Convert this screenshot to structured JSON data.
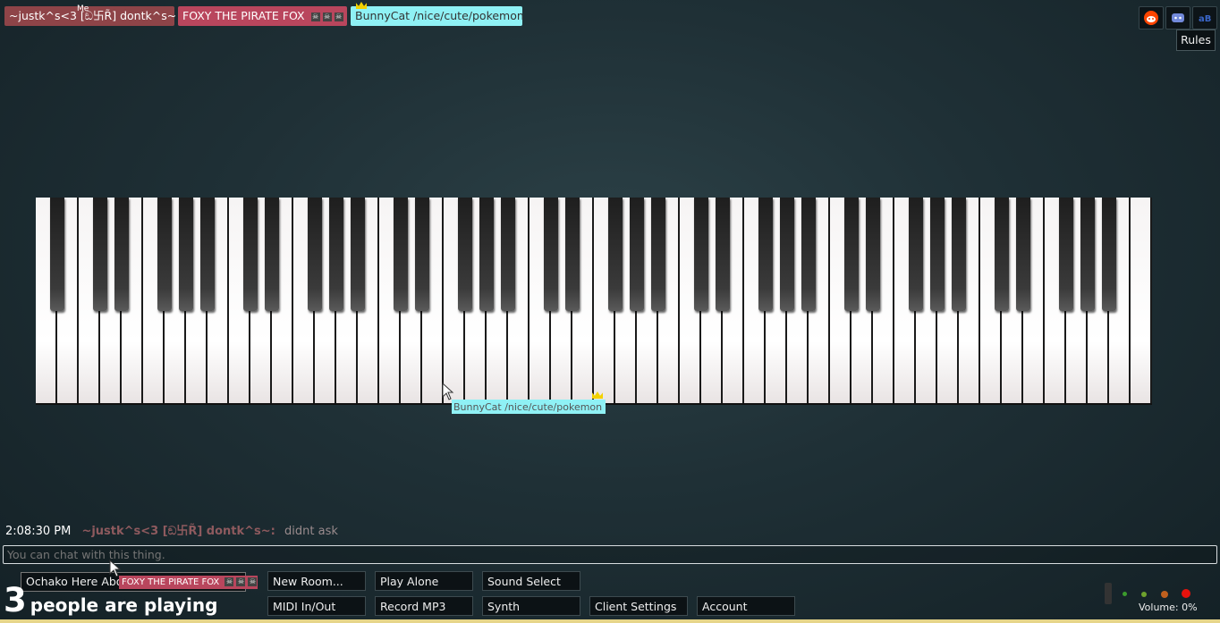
{
  "top_users": [
    {
      "name": "~justk^s<3 [ඞ卐R̃] dontk^s~",
      "badge": "Me",
      "color": "#8e4448"
    },
    {
      "name": "FOXY THE PIRATE FOX",
      "color": "#b9465d"
    },
    {
      "name": "BunnyCat /nice/cute/pokemon",
      "color": "#8ff1f5"
    }
  ],
  "top_icons": [
    "reddit-icon",
    "discord-icon",
    "blog-icon"
  ],
  "rules_label": "Rules",
  "cursor_label": "BunnyCat /nice/cute/pokemon",
  "chat": {
    "time": "2:08:30 PM",
    "name": "~justk^s<3 [ඞ卐R̃] dontk^s~:",
    "message": "didnt ask",
    "input_placeholder": "You can chat with this thing."
  },
  "room": {
    "label": "Ochako Here Abo",
    "owner_tag": "FOXY THE PIRATE FOX"
  },
  "buttons": {
    "new_room": "New Room...",
    "play_alone": "Play Alone",
    "sound_select": "Sound Select",
    "midi": "MIDI In/Out",
    "record": "Record MP3",
    "synth": "Synth",
    "client_settings": "Client Settings",
    "account": "Account"
  },
  "player_count": {
    "number": "3",
    "text": "people are playing"
  },
  "volume": {
    "label": "Volume: 0%",
    "level": 0
  }
}
